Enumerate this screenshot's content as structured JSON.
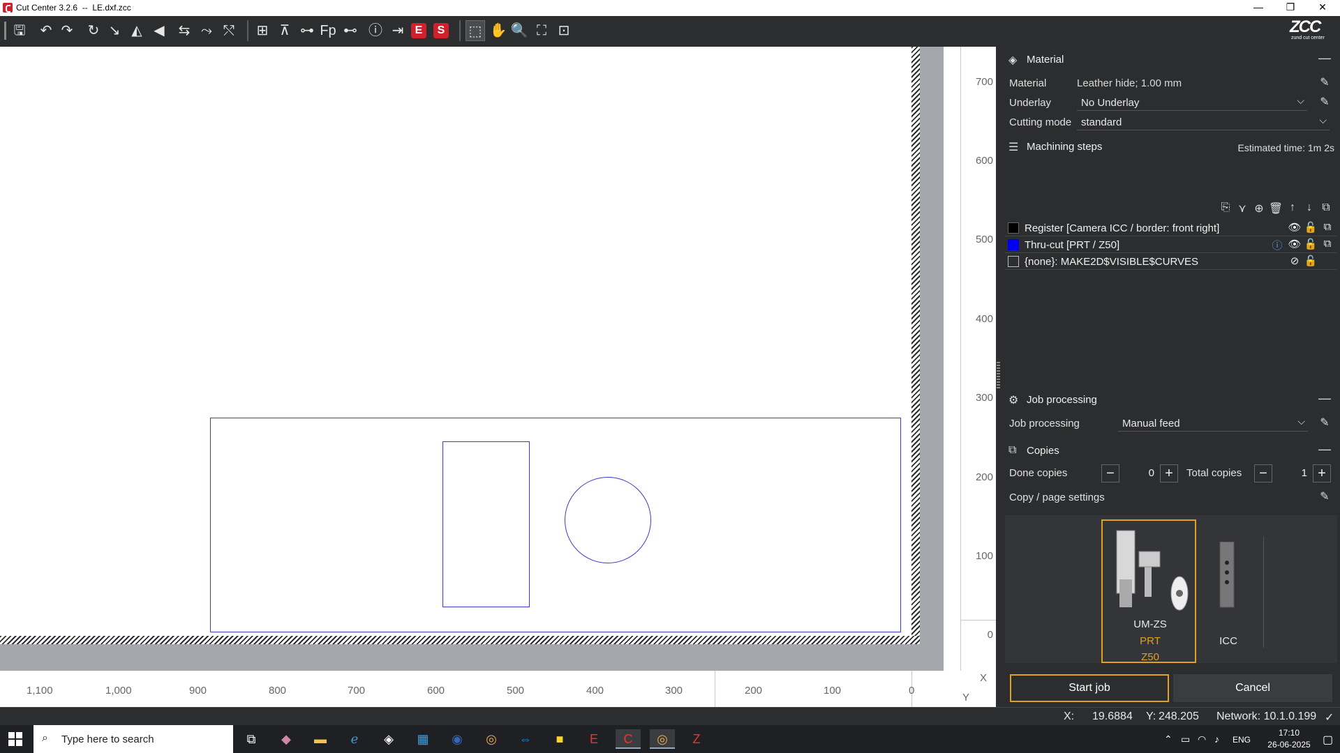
{
  "titlebar": {
    "app_title": "Cut Center 3.2.6  --  LE.dxf.zcc",
    "minimize": "—",
    "restore": "❐",
    "close": "✕"
  },
  "logo": {
    "text": "ZCC",
    "subtitle": "zund cut center"
  },
  "canvas": {
    "y_ticks": [
      "700",
      "600",
      "500",
      "400",
      "300",
      "200",
      "100",
      "0"
    ],
    "x_ticks": [
      "1,100",
      "1,000",
      "900",
      "800",
      "700",
      "600",
      "500",
      "400",
      "300",
      "200",
      "100",
      "0"
    ],
    "x_axis_label": "X",
    "y_axis_label": "Y",
    "shape_color": "#3a3acc"
  },
  "panel": {
    "material": {
      "title": "Material",
      "material_label": "Material",
      "material_value": "Leather hide; 1.00 mm",
      "underlay_label": "Underlay",
      "underlay_value": "No Underlay",
      "cutting_mode_label": "Cutting mode",
      "cutting_mode_value": "standard"
    },
    "machining": {
      "title": "Machining steps",
      "estimated_time": "Estimated time: 1m 2s",
      "steps": [
        {
          "label": "Register [Camera ICC / border: front right]",
          "color": "#000000"
        },
        {
          "label": "Thru-cut [PRT / Z50]",
          "color": "#0000ee"
        },
        {
          "label": "{none}: MAKE2D$VISIBLE$CURVES",
          "color": "#ffffff"
        }
      ]
    },
    "job_processing": {
      "title": "Job processing",
      "label": "Job processing",
      "value": "Manual feed"
    },
    "copies": {
      "title": "Copies",
      "done_label": "Done copies",
      "done_value": "0",
      "total_label": "Total copies",
      "total_value": "1",
      "page_settings_label": "Copy / page settings"
    },
    "tools": [
      {
        "name": "UM-ZS",
        "line2": "PRT",
        "line3": "Z50"
      },
      {
        "name": "ICC"
      }
    ],
    "start_button": "Start job",
    "cancel_button": "Cancel"
  },
  "status": {
    "x_label": "X:",
    "x_value": "19.6884",
    "y_label": "Y:",
    "y_value": "248.205",
    "network": "Network: 10.1.0.199"
  },
  "taskbar": {
    "search_placeholder": "Type here to search",
    "lang": "ENG",
    "time": "17:10",
    "date": "26-06-2025"
  }
}
